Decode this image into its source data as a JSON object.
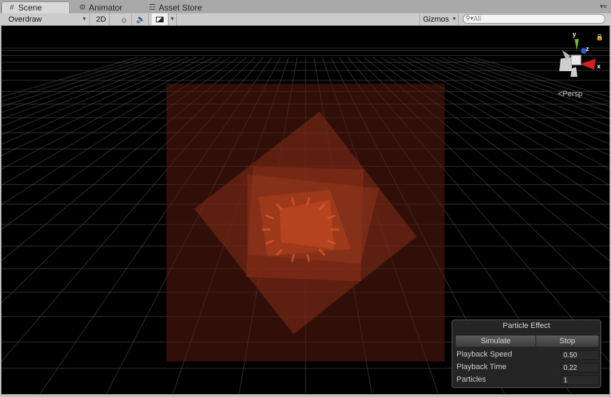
{
  "tabs": [
    {
      "label": "Scene",
      "icon": "scene-hash-icon"
    },
    {
      "label": "Animator",
      "icon": "animator-icon"
    },
    {
      "label": "Asset Store",
      "icon": "asset-store-icon"
    }
  ],
  "toolbar": {
    "render_mode": "Overdraw",
    "two_d": "2D",
    "gizmos": "Gizmos",
    "search_placeholder": "All"
  },
  "scene": {
    "projection_label": "Persp",
    "axes": {
      "x": "x",
      "y": "y",
      "z": "z"
    }
  },
  "particle_panel": {
    "title": "Particle Effect",
    "simulate": "Simulate",
    "stop": "Stop",
    "rows": [
      {
        "label": "Playback Speed",
        "value": "0.50"
      },
      {
        "label": "Playback Time",
        "value": "0.22"
      },
      {
        "label": "Particles",
        "value": "1"
      }
    ]
  },
  "colors": {
    "grid": "#5a5a5a",
    "overdraw": "#d9482a",
    "gizmo_x": "#d02020",
    "gizmo_y": "#6cc02a",
    "gizmo_z": "#2a5ad0"
  }
}
